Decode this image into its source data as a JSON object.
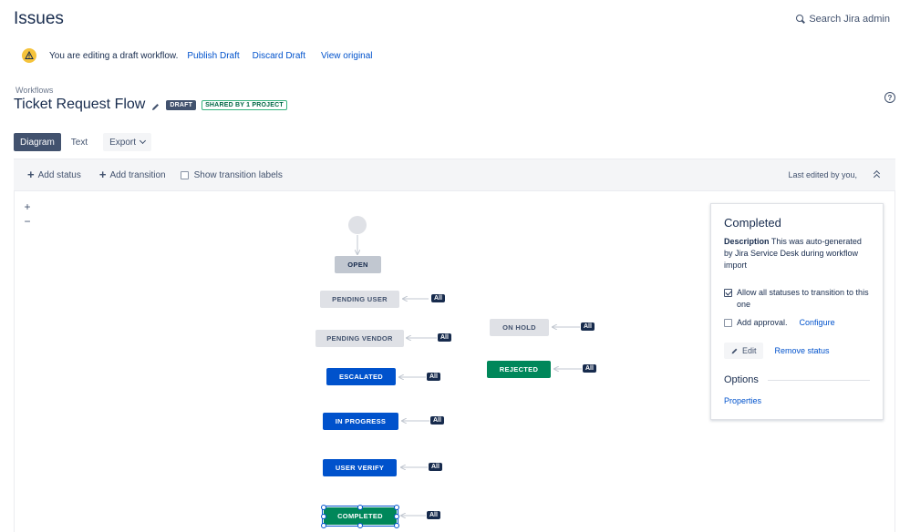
{
  "header": {
    "title": "Issues",
    "search_label": "Search Jira admin"
  },
  "draft_bar": {
    "message": "You are editing a draft workflow.",
    "publish": "Publish Draft",
    "discard": "Discard Draft",
    "view_original": "View original"
  },
  "workflow": {
    "breadcrumb": "Workflows",
    "name": "Ticket Request Flow",
    "draft_badge": "DRAFT",
    "shared_badge": "SHARED BY 1 PROJECT"
  },
  "tabs": {
    "diagram": "Diagram",
    "text": "Text",
    "export": "Export"
  },
  "toolbar": {
    "add_status": "Add status",
    "add_transition": "Add transition",
    "show_labels": "Show transition labels",
    "last_edited": "Last edited by you,"
  },
  "zoom": {
    "in": "+",
    "out": "−"
  },
  "statuses": {
    "open": "OPEN",
    "pending_user": "PENDING USER",
    "pending_vendor": "PENDING VENDOR",
    "escalated": "ESCALATED",
    "in_progress": "IN PROGRESS",
    "user_verify": "USER VERIFY",
    "completed": "COMPLETED",
    "on_hold": "ON HOLD",
    "rejected": "REJECTED"
  },
  "all_label": "All",
  "panel": {
    "title": "Completed",
    "desc_label": "Description",
    "desc_text": " This was auto-generated by Jira Service Desk during workflow import",
    "allow_all": "Allow all statuses to transition to this one",
    "add_approval": "Add approval.",
    "configure": "Configure",
    "edit": "Edit",
    "remove": "Remove status",
    "options_heading": "Options",
    "properties": "Properties"
  },
  "colors": {
    "blue": "#0052cc",
    "green": "#00875a",
    "gray": "#dfe1e6",
    "navy": "#172b4d"
  }
}
